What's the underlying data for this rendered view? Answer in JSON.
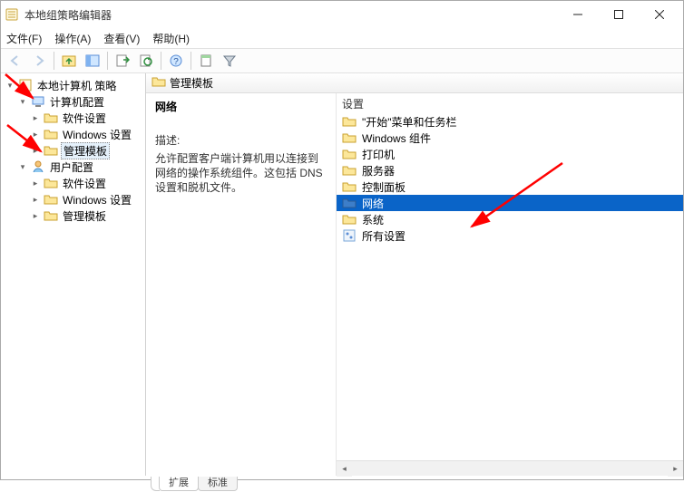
{
  "window": {
    "title": "本地组策略编辑器"
  },
  "menu": {
    "file": "文件(F)",
    "action": "操作(A)",
    "view": "查看(V)",
    "help": "帮助(H)"
  },
  "tree": {
    "root": "本地计算机 策略",
    "computer_cfg": "计算机配置",
    "software1": "软件设置",
    "windows1": "Windows 设置",
    "admin1": "管理模板",
    "user_cfg": "用户配置",
    "software2": "软件设置",
    "windows2": "Windows 设置",
    "admin2": "管理模板"
  },
  "pathbar": {
    "title": "管理模板"
  },
  "description": {
    "title": "网络",
    "label": "描述:",
    "text": "允许配置客户端计算机用以连接到网络的操作系统组件。这包括 DNS 设置和脱机文件。"
  },
  "list": {
    "header": "设置",
    "items": [
      {
        "label": "\"开始\"菜单和任务栏",
        "type": "folder"
      },
      {
        "label": "Windows 组件",
        "type": "folder"
      },
      {
        "label": "打印机",
        "type": "folder"
      },
      {
        "label": "服务器",
        "type": "folder"
      },
      {
        "label": "控制面板",
        "type": "folder"
      },
      {
        "label": "网络",
        "type": "folder",
        "selected": true
      },
      {
        "label": "系统",
        "type": "folder"
      },
      {
        "label": "所有设置",
        "type": "all"
      }
    ]
  },
  "tabs": {
    "extended": "扩展",
    "standard": "标准"
  }
}
